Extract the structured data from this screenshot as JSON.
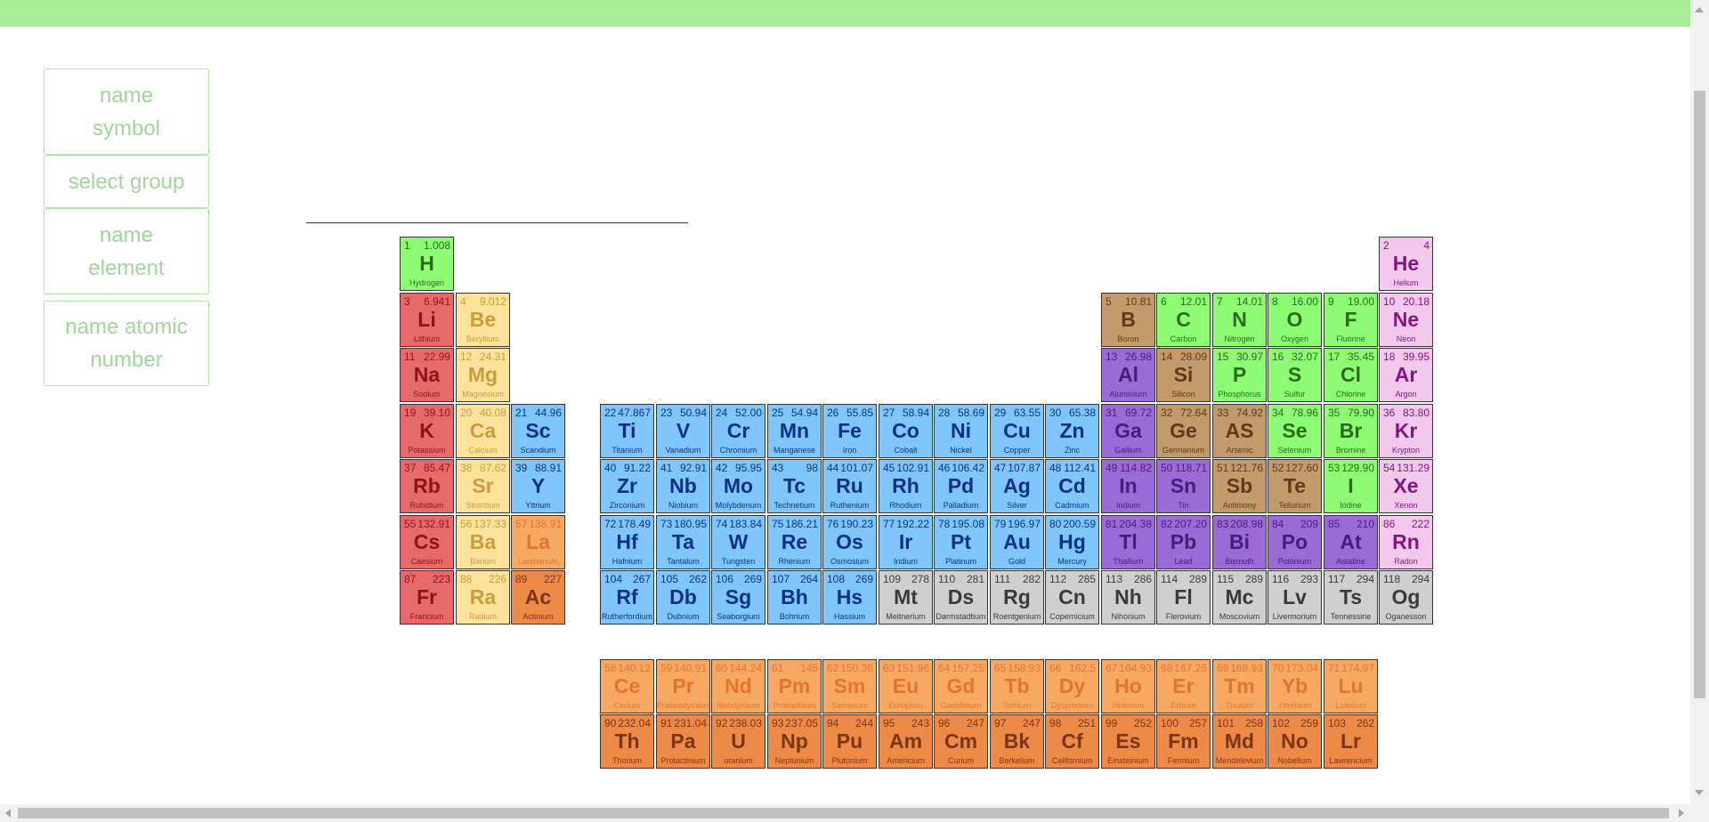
{
  "menu": {
    "name_symbol": [
      "name",
      "symbol"
    ],
    "select_group": "select group",
    "name_element": [
      "name",
      "element"
    ],
    "name_atomic_number": [
      "name atomic",
      "number"
    ]
  },
  "category_colors": {
    "alkali": "#e8696a",
    "alkaline": "#fde29b",
    "transition": "#7fc6fc",
    "lanthanide": "#f7a862",
    "actinide": "#ee8a47",
    "nonmetal": "#8dfb74",
    "metalloid": "#c39a6b",
    "post": "#9a6bd6",
    "noble": "#f2c8ec",
    "unknown": "#cfcfcf"
  },
  "elements": [
    {
      "n": "1",
      "m": "1.008",
      "s": "H",
      "name": "Hydrogen",
      "cat": "nonmetal",
      "row": 1,
      "col": 1
    },
    {
      "n": "2",
      "m": "4",
      "s": "He",
      "name": "Helium",
      "cat": "noble",
      "row": 1,
      "col": 18
    },
    {
      "n": "3",
      "m": "6.941",
      "s": "Li",
      "name": "Lithium",
      "cat": "alkali",
      "row": 2,
      "col": 1
    },
    {
      "n": "4",
      "m": "9.012",
      "s": "Be",
      "name": "Beryllium",
      "cat": "alkaline",
      "row": 2,
      "col": 2
    },
    {
      "n": "5",
      "m": "10.81",
      "s": "B",
      "name": "Boron",
      "cat": "metalloid",
      "row": 2,
      "col": 13
    },
    {
      "n": "6",
      "m": "12.01",
      "s": "C",
      "name": "Carbon",
      "cat": "nonmetal",
      "row": 2,
      "col": 14
    },
    {
      "n": "7",
      "m": "14.01",
      "s": "N",
      "name": "Nitrogen",
      "cat": "nonmetal",
      "row": 2,
      "col": 15
    },
    {
      "n": "8",
      "m": "16.00",
      "s": "O",
      "name": "Oxygen",
      "cat": "nonmetal",
      "row": 2,
      "col": 16
    },
    {
      "n": "9",
      "m": "19.00",
      "s": "F",
      "name": "Fluorine",
      "cat": "nonmetal",
      "row": 2,
      "col": 17
    },
    {
      "n": "10",
      "m": "20.18",
      "s": "Ne",
      "name": "Neon",
      "cat": "noble",
      "row": 2,
      "col": 18
    },
    {
      "n": "11",
      "m": "22.99",
      "s": "Na",
      "name": "Sodium",
      "cat": "alkali",
      "row": 3,
      "col": 1
    },
    {
      "n": "12",
      "m": "24.31",
      "s": "Mg",
      "name": "Magnesium",
      "cat": "alkaline",
      "row": 3,
      "col": 2
    },
    {
      "n": "13",
      "m": "26.98",
      "s": "Al",
      "name": "Aluminium",
      "cat": "post",
      "row": 3,
      "col": 13
    },
    {
      "n": "14",
      "m": "28.09",
      "s": "Si",
      "name": "Silicon",
      "cat": "metalloid",
      "row": 3,
      "col": 14
    },
    {
      "n": "15",
      "m": "30.97",
      "s": "P",
      "name": "Phosphorus",
      "cat": "nonmetal",
      "row": 3,
      "col": 15
    },
    {
      "n": "16",
      "m": "32.07",
      "s": "S",
      "name": "Sulfur",
      "cat": "nonmetal",
      "row": 3,
      "col": 16
    },
    {
      "n": "17",
      "m": "35.45",
      "s": "Cl",
      "name": "Chlorine",
      "cat": "nonmetal",
      "row": 3,
      "col": 17
    },
    {
      "n": "18",
      "m": "39.95",
      "s": "Ar",
      "name": "Argon",
      "cat": "noble",
      "row": 3,
      "col": 18
    },
    {
      "n": "19",
      "m": "39.10",
      "s": "K",
      "name": "Potassium",
      "cat": "alkali",
      "row": 4,
      "col": 1
    },
    {
      "n": "20",
      "m": "40.08",
      "s": "Ca",
      "name": "Calcium",
      "cat": "alkaline",
      "row": 4,
      "col": 2
    },
    {
      "n": "21",
      "m": "44.96",
      "s": "Sc",
      "name": "Scandium",
      "cat": "transition",
      "row": 4,
      "col": 3
    },
    {
      "n": "22",
      "m": "47.867",
      "s": "Ti",
      "name": "Titanium",
      "cat": "transition",
      "row": 4,
      "col": 4
    },
    {
      "n": "23",
      "m": "50.94",
      "s": "V",
      "name": "Vanadium",
      "cat": "transition",
      "row": 4,
      "col": 5
    },
    {
      "n": "24",
      "m": "52.00",
      "s": "Cr",
      "name": "Chromium",
      "cat": "transition",
      "row": 4,
      "col": 6
    },
    {
      "n": "25",
      "m": "54.94",
      "s": "Mn",
      "name": "Manganese",
      "cat": "transition",
      "row": 4,
      "col": 7
    },
    {
      "n": "26",
      "m": "55.85",
      "s": "Fe",
      "name": "Iron",
      "cat": "transition",
      "row": 4,
      "col": 8
    },
    {
      "n": "27",
      "m": "58.94",
      "s": "Co",
      "name": "Cobalt",
      "cat": "transition",
      "row": 4,
      "col": 9
    },
    {
      "n": "28",
      "m": "58.69",
      "s": "Ni",
      "name": "Nickel",
      "cat": "transition",
      "row": 4,
      "col": 10
    },
    {
      "n": "29",
      "m": "63.55",
      "s": "Cu",
      "name": "Copper",
      "cat": "transition",
      "row": 4,
      "col": 11
    },
    {
      "n": "30",
      "m": "65.38",
      "s": "Zn",
      "name": "Zinc",
      "cat": "transition",
      "row": 4,
      "col": 12
    },
    {
      "n": "31",
      "m": "69.72",
      "s": "Ga",
      "name": "Gallium",
      "cat": "post",
      "row": 4,
      "col": 13
    },
    {
      "n": "32",
      "m": "72.64",
      "s": "Ge",
      "name": "Germanium",
      "cat": "metalloid",
      "row": 4,
      "col": 14
    },
    {
      "n": "33",
      "m": "74.92",
      "s": "AS",
      "name": "Arsenic",
      "cat": "metalloid",
      "row": 4,
      "col": 15
    },
    {
      "n": "34",
      "m": "78.96",
      "s": "Se",
      "name": "Selenium",
      "cat": "nonmetal",
      "row": 4,
      "col": 16
    },
    {
      "n": "35",
      "m": "79.90",
      "s": "Br",
      "name": "Bromine",
      "cat": "nonmetal",
      "row": 4,
      "col": 17
    },
    {
      "n": "36",
      "m": "83.80",
      "s": "Kr",
      "name": "Krypton",
      "cat": "noble",
      "row": 4,
      "col": 18
    },
    {
      "n": "37",
      "m": "85.47",
      "s": "Rb",
      "name": "Rubidium",
      "cat": "alkali",
      "row": 5,
      "col": 1
    },
    {
      "n": "38",
      "m": "87.62",
      "s": "Sr",
      "name": "Strontium",
      "cat": "alkaline",
      "row": 5,
      "col": 2
    },
    {
      "n": "39",
      "m": "88.91",
      "s": "Y",
      "name": "Yttrium",
      "cat": "transition",
      "row": 5,
      "col": 3
    },
    {
      "n": "40",
      "m": "91.22",
      "s": "Zr",
      "name": "Zirconium",
      "cat": "transition",
      "row": 5,
      "col": 4
    },
    {
      "n": "41",
      "m": "92.91",
      "s": "Nb",
      "name": "Niobium",
      "cat": "transition",
      "row": 5,
      "col": 5
    },
    {
      "n": "42",
      "m": "95.95",
      "s": "Mo",
      "name": "Molybdenum",
      "cat": "transition",
      "row": 5,
      "col": 6
    },
    {
      "n": "43",
      "m": "98",
      "s": "Tc",
      "name": "Technetium",
      "cat": "transition",
      "row": 5,
      "col": 7
    },
    {
      "n": "44",
      "m": "101.07",
      "s": "Ru",
      "name": "Ruthenium",
      "cat": "transition",
      "row": 5,
      "col": 8
    },
    {
      "n": "45",
      "m": "102.91",
      "s": "Rh",
      "name": "Rhodium",
      "cat": "transition",
      "row": 5,
      "col": 9
    },
    {
      "n": "46",
      "m": "106.42",
      "s": "Pd",
      "name": "Palladium",
      "cat": "transition",
      "row": 5,
      "col": 10
    },
    {
      "n": "47",
      "m": "107.87",
      "s": "Ag",
      "name": "Silver",
      "cat": "transition",
      "row": 5,
      "col": 11
    },
    {
      "n": "48",
      "m": "112.41",
      "s": "Cd",
      "name": "Cadmium",
      "cat": "transition",
      "row": 5,
      "col": 12
    },
    {
      "n": "49",
      "m": "114.82",
      "s": "In",
      "name": "Indium",
      "cat": "post",
      "row": 5,
      "col": 13
    },
    {
      "n": "50",
      "m": "118.71",
      "s": "Sn",
      "name": "Tin",
      "cat": "post",
      "row": 5,
      "col": 14
    },
    {
      "n": "51",
      "m": "121.76",
      "s": "Sb",
      "name": "Antimony",
      "cat": "metalloid",
      "row": 5,
      "col": 15
    },
    {
      "n": "52",
      "m": "127.60",
      "s": "Te",
      "name": "Tellurium",
      "cat": "metalloid",
      "row": 5,
      "col": 16
    },
    {
      "n": "53",
      "m": "129.90",
      "s": "I",
      "name": "Iodine",
      "cat": "nonmetal",
      "row": 5,
      "col": 17
    },
    {
      "n": "54",
      "m": "131.29",
      "s": "Xe",
      "name": "Xenon",
      "cat": "noble",
      "row": 5,
      "col": 18
    },
    {
      "n": "55",
      "m": "132.91",
      "s": "Cs",
      "name": "Caesium",
      "cat": "alkali",
      "row": 6,
      "col": 1
    },
    {
      "n": "56",
      "m": "137.33",
      "s": "Ba",
      "name": "Barium",
      "cat": "alkaline",
      "row": 6,
      "col": 2
    },
    {
      "n": "57",
      "m": "138.91",
      "s": "La",
      "name": "Lanthanum",
      "cat": "lanthanide",
      "row": 6,
      "col": 3
    },
    {
      "n": "72",
      "m": "178.49",
      "s": "Hf",
      "name": "Hafnium",
      "cat": "transition",
      "row": 6,
      "col": 4
    },
    {
      "n": "73",
      "m": "180.95",
      "s": "Ta",
      "name": "Tantalum",
      "cat": "transition",
      "row": 6,
      "col": 5
    },
    {
      "n": "74",
      "m": "183.84",
      "s": "W",
      "name": "Tungsten",
      "cat": "transition",
      "row": 6,
      "col": 6
    },
    {
      "n": "75",
      "m": "186.21",
      "s": "Re",
      "name": "Rhenium",
      "cat": "transition",
      "row": 6,
      "col": 7
    },
    {
      "n": "76",
      "m": "190.23",
      "s": "Os",
      "name": "Osmosium",
      "cat": "transition",
      "row": 6,
      "col": 8
    },
    {
      "n": "77",
      "m": "192.22",
      "s": "Ir",
      "name": "Iridium",
      "cat": "transition",
      "row": 6,
      "col": 9
    },
    {
      "n": "78",
      "m": "195.08",
      "s": "Pt",
      "name": "Platinum",
      "cat": "transition",
      "row": 6,
      "col": 10
    },
    {
      "n": "79",
      "m": "196.97",
      "s": "Au",
      "name": "Gold",
      "cat": "transition",
      "row": 6,
      "col": 11
    },
    {
      "n": "80",
      "m": "200.59",
      "s": "Hg",
      "name": "Mercury",
      "cat": "transition",
      "row": 6,
      "col": 12
    },
    {
      "n": "81",
      "m": "204.38",
      "s": "Tl",
      "name": "Thallium",
      "cat": "post",
      "row": 6,
      "col": 13
    },
    {
      "n": "82",
      "m": "207.20",
      "s": "Pb",
      "name": "Lead",
      "cat": "post",
      "row": 6,
      "col": 14
    },
    {
      "n": "83",
      "m": "208.98",
      "s": "Bi",
      "name": "Bismuth",
      "cat": "post",
      "row": 6,
      "col": 15
    },
    {
      "n": "84",
      "m": "209",
      "s": "Po",
      "name": "Polonium",
      "cat": "post",
      "row": 6,
      "col": 16
    },
    {
      "n": "85",
      "m": "210",
      "s": "At",
      "name": "Astatine",
      "cat": "post",
      "row": 6,
      "col": 17
    },
    {
      "n": "86",
      "m": "222",
      "s": "Rn",
      "name": "Radon",
      "cat": "noble",
      "row": 6,
      "col": 18
    },
    {
      "n": "87",
      "m": "223",
      "s": "Fr",
      "name": "Francium",
      "cat": "alkali",
      "row": 7,
      "col": 1
    },
    {
      "n": "88",
      "m": "226",
      "s": "Ra",
      "name": "Radium",
      "cat": "alkaline",
      "row": 7,
      "col": 2
    },
    {
      "n": "89",
      "m": "227",
      "s": "Ac",
      "name": "Actinium",
      "cat": "actinide",
      "row": 7,
      "col": 3
    },
    {
      "n": "104",
      "m": "267",
      "s": "Rf",
      "name": "Rutherfordium",
      "cat": "transition",
      "row": 7,
      "col": 4
    },
    {
      "n": "105",
      "m": "262",
      "s": "Db",
      "name": "Dubnium",
      "cat": "transition",
      "row": 7,
      "col": 5
    },
    {
      "n": "106",
      "m": "269",
      "s": "Sg",
      "name": "Seaborgium",
      "cat": "transition",
      "row": 7,
      "col": 6
    },
    {
      "n": "107",
      "m": "264",
      "s": "Bh",
      "name": "Bohrium",
      "cat": "transition",
      "row": 7,
      "col": 7
    },
    {
      "n": "108",
      "m": "269",
      "s": "Hs",
      "name": "Hassium",
      "cat": "transition",
      "row": 7,
      "col": 8
    },
    {
      "n": "109",
      "m": "278",
      "s": "Mt",
      "name": "Meitnerium",
      "cat": "unknown",
      "row": 7,
      "col": 9
    },
    {
      "n": "110",
      "m": "281",
      "s": "Ds",
      "name": "Darmstadtium",
      "cat": "unknown",
      "row": 7,
      "col": 10
    },
    {
      "n": "111",
      "m": "282",
      "s": "Rg",
      "name": "Roentgenium",
      "cat": "unknown",
      "row": 7,
      "col": 11
    },
    {
      "n": "112",
      "m": "285",
      "s": "Cn",
      "name": "Copernicium",
      "cat": "unknown",
      "row": 7,
      "col": 12
    },
    {
      "n": "113",
      "m": "286",
      "s": "Nh",
      "name": "Nihonium",
      "cat": "unknown",
      "row": 7,
      "col": 13
    },
    {
      "n": "114",
      "m": "289",
      "s": "Fl",
      "name": "Flerovium",
      "cat": "unknown",
      "row": 7,
      "col": 14
    },
    {
      "n": "115",
      "m": "289",
      "s": "Mc",
      "name": "Moscovium",
      "cat": "unknown",
      "row": 7,
      "col": 15
    },
    {
      "n": "116",
      "m": "293",
      "s": "Lv",
      "name": "Livermorium",
      "cat": "unknown",
      "row": 7,
      "col": 16
    },
    {
      "n": "117",
      "m": "294",
      "s": "Ts",
      "name": "Tennessine",
      "cat": "unknown",
      "row": 7,
      "col": 17
    },
    {
      "n": "118",
      "m": "294",
      "s": "Og",
      "name": "Oganesson",
      "cat": "unknown",
      "row": 7,
      "col": 18
    },
    {
      "n": "58",
      "m": "140.12",
      "s": "Ce",
      "name": "Cerium",
      "cat": "lanthanide",
      "row": 9,
      "col": 4
    },
    {
      "n": "59",
      "m": "140.91",
      "s": "Pr",
      "name": "Praseodymium",
      "cat": "lanthanide",
      "row": 9,
      "col": 5
    },
    {
      "n": "60",
      "m": "144.24",
      "s": "Nd",
      "name": "Neodymium",
      "cat": "lanthanide",
      "row": 9,
      "col": 6
    },
    {
      "n": "61",
      "m": "145",
      "s": "Pm",
      "name": "Promethium",
      "cat": "lanthanide",
      "row": 9,
      "col": 7
    },
    {
      "n": "62",
      "m": "150.36",
      "s": "Sm",
      "name": "Samarium",
      "cat": "lanthanide",
      "row": 9,
      "col": 8
    },
    {
      "n": "63",
      "m": "151.96",
      "s": "Eu",
      "name": "Europium",
      "cat": "lanthanide",
      "row": 9,
      "col": 9
    },
    {
      "n": "64",
      "m": "157.25",
      "s": "Gd",
      "name": "Gadolinium",
      "cat": "lanthanide",
      "row": 9,
      "col": 10
    },
    {
      "n": "65",
      "m": "158.93",
      "s": "Tb",
      "name": "Terbium",
      "cat": "lanthanide",
      "row": 9,
      "col": 11
    },
    {
      "n": "66",
      "m": "162.5",
      "s": "Dy",
      "name": "Dysprosium",
      "cat": "lanthanide",
      "row": 9,
      "col": 12
    },
    {
      "n": "67",
      "m": "164.93",
      "s": "Ho",
      "name": "Holmium",
      "cat": "lanthanide",
      "row": 9,
      "col": 13
    },
    {
      "n": "68",
      "m": "167.26",
      "s": "Er",
      "name": "Erbium",
      "cat": "lanthanide",
      "row": 9,
      "col": 14
    },
    {
      "n": "69",
      "m": "168.93",
      "s": "Tm",
      "name": "Thulium",
      "cat": "lanthanide",
      "row": 9,
      "col": 15
    },
    {
      "n": "70",
      "m": "173.04",
      "s": "Yb",
      "name": "Ytterbium",
      "cat": "lanthanide",
      "row": 9,
      "col": 16
    },
    {
      "n": "71",
      "m": "174.97",
      "s": "Lu",
      "name": "Lutetium",
      "cat": "lanthanide",
      "row": 9,
      "col": 17
    },
    {
      "n": "90",
      "m": "232.04",
      "s": "Th",
      "name": "Thorium",
      "cat": "actinide",
      "row": 10,
      "col": 4
    },
    {
      "n": "91",
      "m": "231.04",
      "s": "Pa",
      "name": "Protactinium",
      "cat": "actinide",
      "row": 10,
      "col": 5
    },
    {
      "n": "92",
      "m": "238.03",
      "s": "U",
      "name": "uranium",
      "cat": "actinide",
      "row": 10,
      "col": 6
    },
    {
      "n": "93",
      "m": "237.05",
      "s": "Np",
      "name": "Neptunium",
      "cat": "actinide",
      "row": 10,
      "col": 7
    },
    {
      "n": "94",
      "m": "244",
      "s": "Pu",
      "name": "Plutonium",
      "cat": "actinide",
      "row": 10,
      "col": 8
    },
    {
      "n": "95",
      "m": "243",
      "s": "Am",
      "name": "Americium",
      "cat": "actinide",
      "row": 10,
      "col": 9
    },
    {
      "n": "96",
      "m": "247",
      "s": "Cm",
      "name": "Curium",
      "cat": "actinide",
      "row": 10,
      "col": 10
    },
    {
      "n": "97",
      "m": "247",
      "s": "Bk",
      "name": "Berkelium",
      "cat": "actinide",
      "row": 10,
      "col": 11
    },
    {
      "n": "98",
      "m": "251",
      "s": "Cf",
      "name": "Californium",
      "cat": "actinide",
      "row": 10,
      "col": 12
    },
    {
      "n": "99",
      "m": "252",
      "s": "Es",
      "name": "Einsteinium",
      "cat": "actinide",
      "row": 10,
      "col": 13
    },
    {
      "n": "100",
      "m": "257",
      "s": "Fm",
      "name": "Fermium",
      "cat": "actinide",
      "row": 10,
      "col": 14
    },
    {
      "n": "101",
      "m": "258",
      "s": "Md",
      "name": "Mendelevium",
      "cat": "actinide",
      "row": 10,
      "col": 15
    },
    {
      "n": "102",
      "m": "259",
      "s": "No",
      "name": "Nobelium",
      "cat": "actinide",
      "row": 10,
      "col": 16
    },
    {
      "n": "103",
      "m": "262",
      "s": "Lr",
      "name": "Lawrencium",
      "cat": "actinide",
      "row": 10,
      "col": 17
    }
  ]
}
